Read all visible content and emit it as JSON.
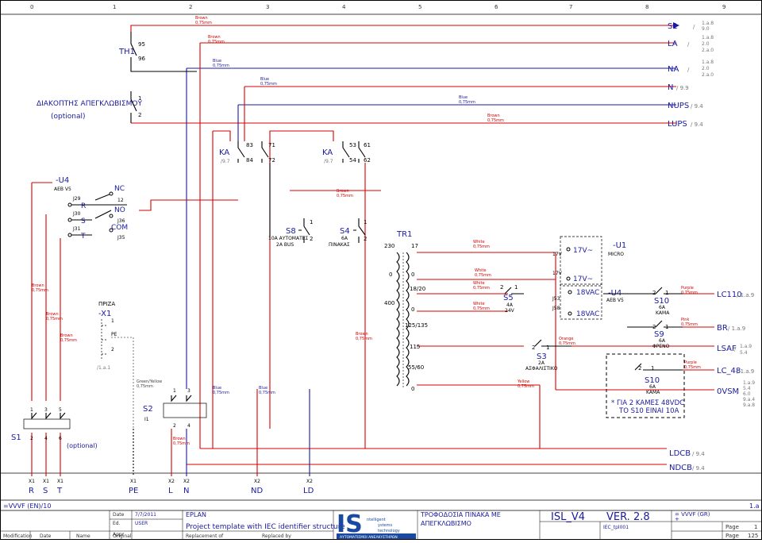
{
  "ruler": {
    "columns": [
      "0",
      "1",
      "2",
      "3",
      "4",
      "5",
      "6",
      "7",
      "8",
      "9"
    ]
  },
  "wire_labels": {
    "brown_a": "Brown",
    "brown_size_a": "0,75mm",
    "brown_b": "Brown",
    "brown_size_b": "0,75mm",
    "blue_a": "Blue",
    "blue_size_a": "0,75mm",
    "blue_b": "Blue",
    "blue_size_b": "0,75mm",
    "blue_c": "Blue",
    "blue_size_c": "0,75mm",
    "brown_c": "Brown",
    "brown_size_c": "0,75mm",
    "brown_d": "Brown",
    "brown_size_d": "0,75mm",
    "white_a": "White",
    "white_size_a": "0,75mm",
    "white_b": "White",
    "white_size_b": "0,75mm",
    "white_c": "White",
    "white_size_c": "0,75mm",
    "white_d": "White",
    "white_size_d": "0,75mm",
    "purple_a": "Purple",
    "purple_size_a": "0,75mm",
    "pink": "Pink",
    "pink_size": "0,75mm",
    "orange": "Orange",
    "orange_size": "0,75mm",
    "purple_b": "Purple",
    "purple_size_b": "0,75mm",
    "yellow": "Yellow",
    "yellow_size": "0,75mm",
    "brown_e": "Brown",
    "brown_size_e": "0,75mm",
    "brown_f": "Brown",
    "brown_size_f": "0,75mm",
    "brown_g": "Brown",
    "brown_size_g": "0,75mm",
    "brown_h": "Brown",
    "brown_size_h": "0,75mm",
    "gy": "Green/Yellow",
    "gy_size": "0,75mm",
    "blue_d": "Blue",
    "blue_size_d": "0,75mm",
    "blue_e": "Blue",
    "blue_size_e": "0,75mm",
    "brown_i": "Brown",
    "brown_size_i": "0,75mm"
  },
  "right_terminals": {
    "s1": "S1",
    "s1_ref": "/",
    "s1_a": "1.a.8",
    "s1_b": "9.0",
    "la": "LA",
    "la_ref": "/",
    "la_a": "1.a.8",
    "la_b": "2.0",
    "la_c": "2.a.0",
    "na": "NA",
    "na_ref": "/",
    "na_a": "1.a.8",
    "na_b": "2.0",
    "na_c": "2.a.0",
    "n": "N",
    "n_ref": "/ 9.9",
    "nups": "NUPS",
    "nups_ref": "/ 9.4",
    "lups": "LUPS",
    "lups_ref": "/ 9.4",
    "lc110": "LC110",
    "lc110_ref": "/ 1.a.9",
    "br": "BR",
    "br_ref": "/ 1.a.9",
    "lsaf": "LSAF",
    "lsaf_ref": "/",
    "lsaf_a": "1.a.9",
    "lsaf_b": "5.4",
    "lc48": "LC_48",
    "lc48_ref": "/ 1.a.9",
    "ovsm": "0VSM",
    "ovsm_ref": "/",
    "ovsm_a": "1.a.9",
    "ovsm_b": "5.4",
    "ovsm_c": "6.0",
    "ovsm_d": "9.a.4",
    "ovsm_e": "9.a.8",
    "ldcb": "LDCB",
    "ldcb_ref": "/ 9.4",
    "ndcb": "NDCB",
    "ndcb_ref": "/ 9.4"
  },
  "components": {
    "th1": "TH1",
    "th1_a": "95",
    "th1_b": "96",
    "sw_title": "ΔΙΑΚΟΠΤΗΣ ΑΠΕΓΚΛΩΒΙΣΜΟΥ",
    "sw_opt": "(optional)",
    "sw_1": "1",
    "sw_2": "2",
    "ka1": "KA",
    "ka1_ref": "/9.7",
    "ka1_83": "83",
    "ka1_84": "84",
    "ka1_71": "71",
    "ka1_72": "72",
    "ka2": "KA",
    "ka2_ref": "/9.7",
    "ka2_53": "53",
    "ka2_54": "54",
    "ka2_61": "61",
    "ka2_62": "62",
    "u4": "-U4",
    "u4_sub": "AEB V5",
    "j29": "J29",
    "r": "R",
    "j30": "J30",
    "s": "S",
    "j31": "J31",
    "t": "T",
    "nc": "NC",
    "no": "NO",
    "n12": "12",
    "j36": "J36",
    "com": "COM",
    "j35": "J35",
    "s8": "S8",
    "s8_1": "1",
    "s8_2": "2",
    "s8_t1": "10A ΑΥΤΟΜΑΤΕΣ",
    "s8_t2": "2A BUS",
    "s4": "S4",
    "s4_1": "1",
    "s4_2": "2",
    "s4_t1": "6A",
    "s4_t2": "ΠΙΝΑΚΑΣ",
    "tr1": "TR1",
    "tr_230": "230",
    "tr_17": "17",
    "tr_0a": "0",
    "tr_0b": "0",
    "tr_400": "400",
    "tr_1820": "18/20",
    "tr_0c": "0",
    "tr_125": "125/135",
    "tr_115": "115",
    "tr_5560": "55/60",
    "tr_0d": "0",
    "u1_17a": "17V",
    "u1_17b": "17V~",
    "u1": "-U1",
    "u1_sub": "MICRO",
    "u1_17c": "17V",
    "u1_17d": "17V~",
    "s5": "S5",
    "s5_2": "2",
    "s5_1": "1",
    "s5_t1": "4A",
    "s5_t2": "24V",
    "j53": "J53",
    "j58": "J58",
    "v18a": "18VAC",
    "v18b": "18VAC",
    "u4b": "-U4",
    "u4b_sub": "AEB V5",
    "s10": "S10",
    "s10_2": "2",
    "s10_1": "1",
    "s10_t1": "6A",
    "s10_t2": "ΚΑΜΑ",
    "s9": "S9",
    "s9_2": "2",
    "s9_1": "1",
    "s9_t1": "6A",
    "s9_t2": "ΦΡΕΝΟ",
    "s3": "S3",
    "s3_2": "2",
    "s3_1": "1",
    "s3_t1": "2A",
    "s3_t2": "ΑΣΦΑΛΙΣΤΙΚΟ",
    "s10b": "S10",
    "s10b_2": "2",
    "s10b_1": "1",
    "s10b_t1": "6A",
    "s10b_t2": "ΚΑΜΑ",
    "note1": "* ΓΙΑ 2 ΚΑΜΕΣ 48VDC",
    "note2": "ΤΟ S10 ΕΙΝΑΙ 10A",
    "priza": "ΠΡΙΖΑ",
    "x1": "-X1",
    "x1_1": "1",
    "x1_pe": "PE",
    "x1_2": "2",
    "x1_ref": "/1.a.1",
    "s2": "S2",
    "s2_i1": "I1",
    "s2_1": "1",
    "s2_3": "3",
    "s2_2": "2",
    "s2_4": "4",
    "s1": "S1",
    "s1_1": "1",
    "s1_3": "3",
    "s1_5": "5",
    "s1_2": "2",
    "s1_4": "4",
    "s1_6": "6",
    "s1_opt": "(optional)"
  },
  "bottom_terminals": [
    {
      "strip": "X1",
      "label": "R"
    },
    {
      "strip": "X1",
      "label": "S"
    },
    {
      "strip": "X1",
      "label": "T"
    },
    {
      "strip": "X1",
      "label": "PE"
    },
    {
      "strip": "X2",
      "label": "L"
    },
    {
      "strip": "X2",
      "label": "N"
    },
    {
      "strip": "X2",
      "label": "ND"
    },
    {
      "strip": "X2",
      "label": "LD"
    }
  ],
  "footer": {
    "left_ref": "=VVVF (EN)/10",
    "right_ref": "1.a",
    "date_lbl": "Date",
    "date_val": "7/7/2011",
    "ed_lbl": "Ed.",
    "ed_val": "USER",
    "appr_lbl": "Appr",
    "mod": "Modification",
    "date2": "Date",
    "name": "Name",
    "original": "Original",
    "eplan": "EPLAN",
    "project": "Project template with IEC identifier structure",
    "replacement": "Replacement of",
    "replaced": "Replaced by",
    "logo_letters": "IS",
    "logo_l1": "ntelligent",
    "logo_l2": "ystems",
    "logo_l3": "technology",
    "logo_sub": "ΑΥΤΟΜΑΤΙΣΜΟΙ ΑΝΕΛΚΥΣΤΗΡΩΝ",
    "desc1": "ΤΡΟΦΟΔΟΣΙΑ ΠΙΝΑΚΑ ΜΕ",
    "desc2": "ΑΠΕΓΚΛΩΒΙΣΜΟ",
    "model": "ISL_V4",
    "version": "VER. 2.8",
    "tpl": "IEC_tpl001",
    "eq1": "= VVVF (GR)",
    "plus": "+",
    "page_lbl": "Page",
    "page_val": "1",
    "page2_lbl": "Page",
    "page2_val": "125"
  }
}
